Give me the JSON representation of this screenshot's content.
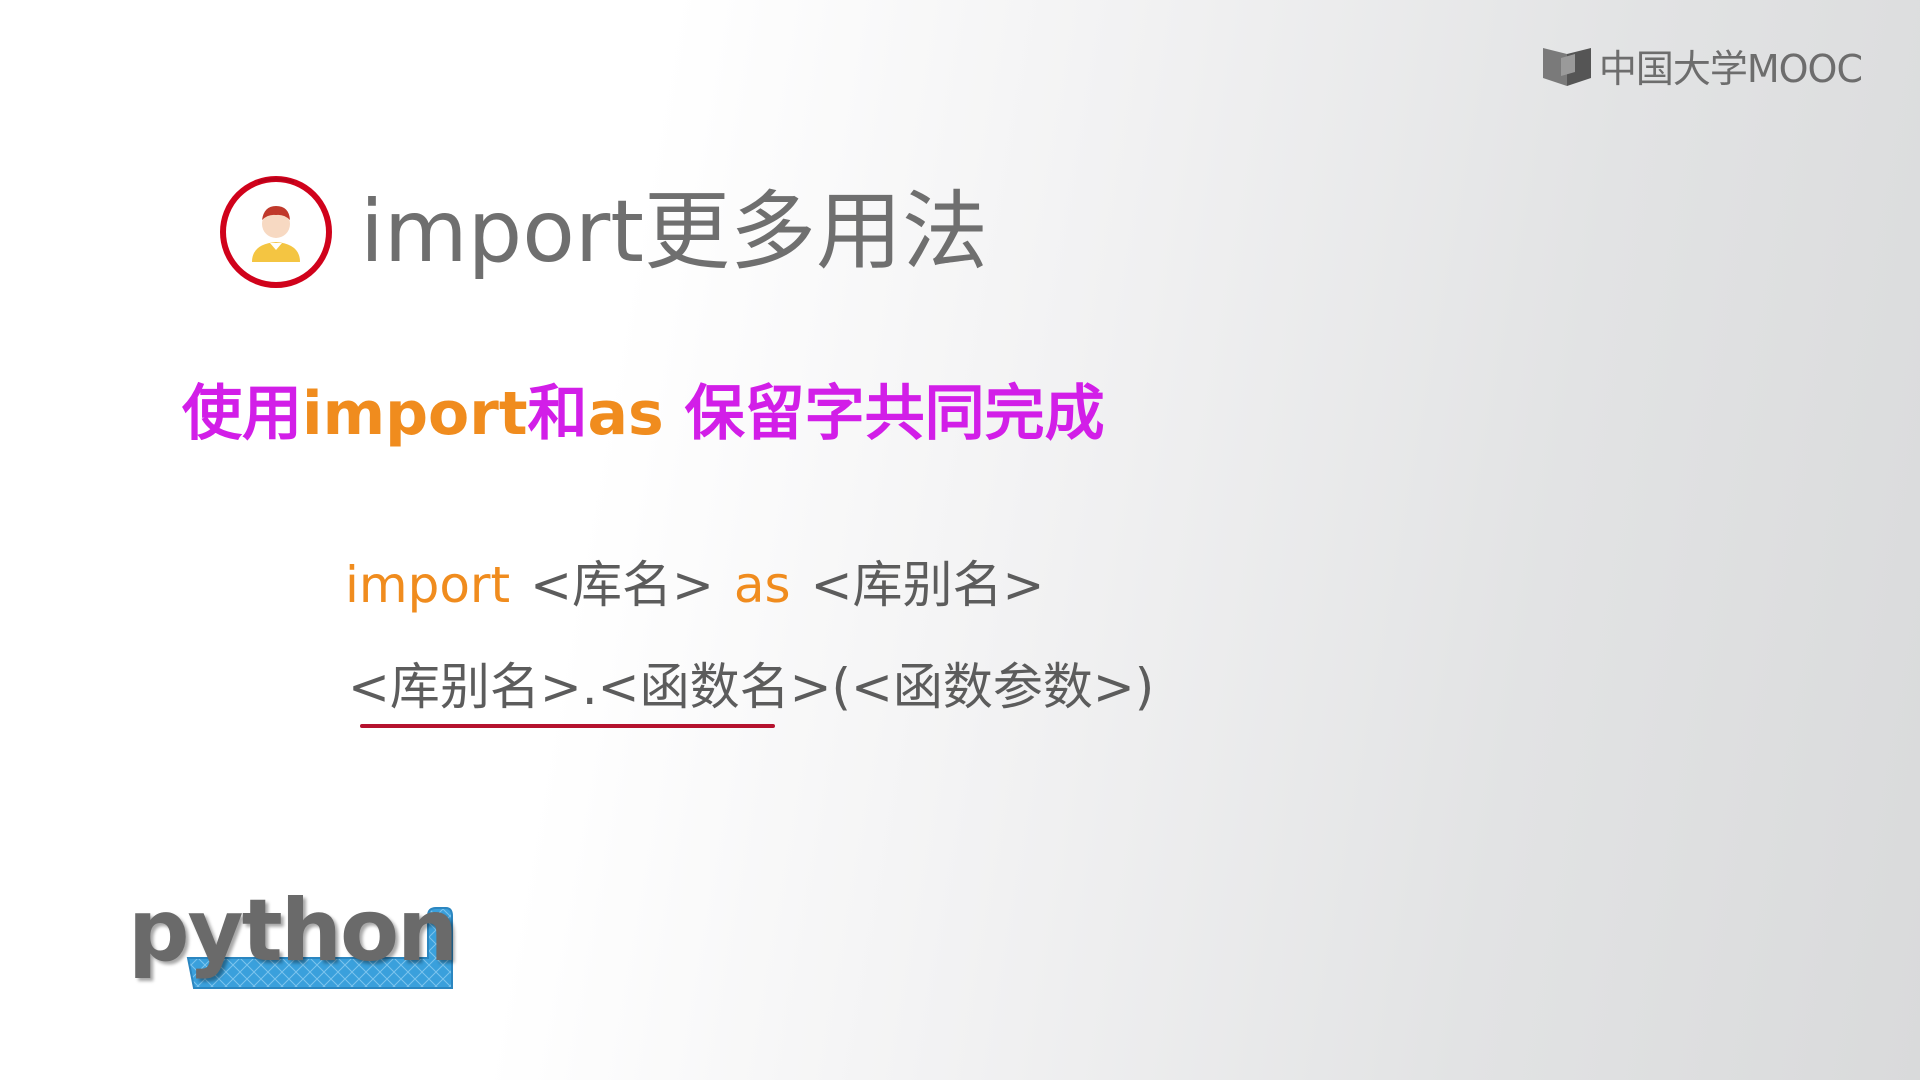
{
  "watermark": {
    "text": "中国大学MOOC",
    "icon": "mooc-book-icon"
  },
  "title": {
    "text": "import更多用法",
    "icon": "person-avatar-icon"
  },
  "subtitle": {
    "part1": "使用",
    "part2": "import",
    "part3": "和",
    "part4": "as",
    "part5": " 保留字共同完成"
  },
  "code": {
    "line1_kw1": "import",
    "line1_arg1": "<库名>",
    "line1_kw2": "as",
    "line1_arg2": "<库别名>",
    "line2": "<库别名>.<函数名>(<函数参数>)"
  },
  "logo": {
    "text": "python"
  },
  "colors": {
    "magenta": "#d21ee8",
    "orange": "#f08c1e",
    "gray_text": "#6f6f6f",
    "ring_red": "#d0021b",
    "underline_red": "#b5122e",
    "logo_blue": "#3aa0dc"
  }
}
